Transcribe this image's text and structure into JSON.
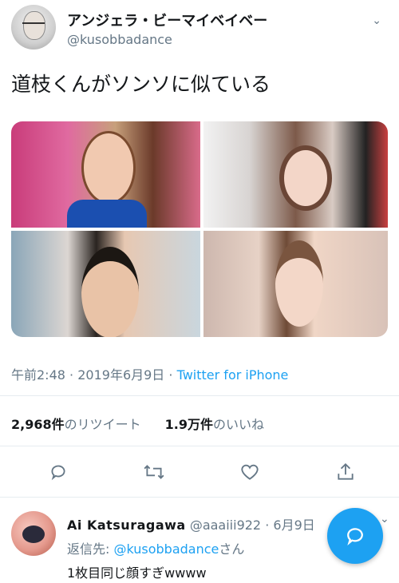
{
  "author": {
    "display_name": "アンジェラ・ビーマイベイベー",
    "handle": "@kusobbadance"
  },
  "tweet": {
    "text": "道枝くんがソンソに似ている",
    "time": "午前2:48",
    "date": "2019年6月9日",
    "separator": "·",
    "source": "Twitter for iPhone"
  },
  "stats": {
    "retweets_count": "2,968件",
    "retweets_label": "のリツイート",
    "likes_count": "1.9万件",
    "likes_label": "のいいね"
  },
  "actions": {
    "reply_icon": "reply-icon",
    "retweet_icon": "retweet-icon",
    "like_icon": "heart-icon",
    "share_icon": "share-icon"
  },
  "reply": {
    "display_name": "Ai Katsuragawa",
    "handle": "@aaaiii922",
    "separator": "·",
    "date": "6月9日",
    "reply_to_prefix": "返信先: ",
    "reply_to_handle": "@kusobbadance",
    "reply_to_suffix": "さん",
    "text": "1枚目同じ顔すぎwwww"
  },
  "colors": {
    "accent": "#1da1f2",
    "secondary_text": "#657786",
    "primary_text": "#14171a",
    "divider": "#e6ecf0"
  }
}
